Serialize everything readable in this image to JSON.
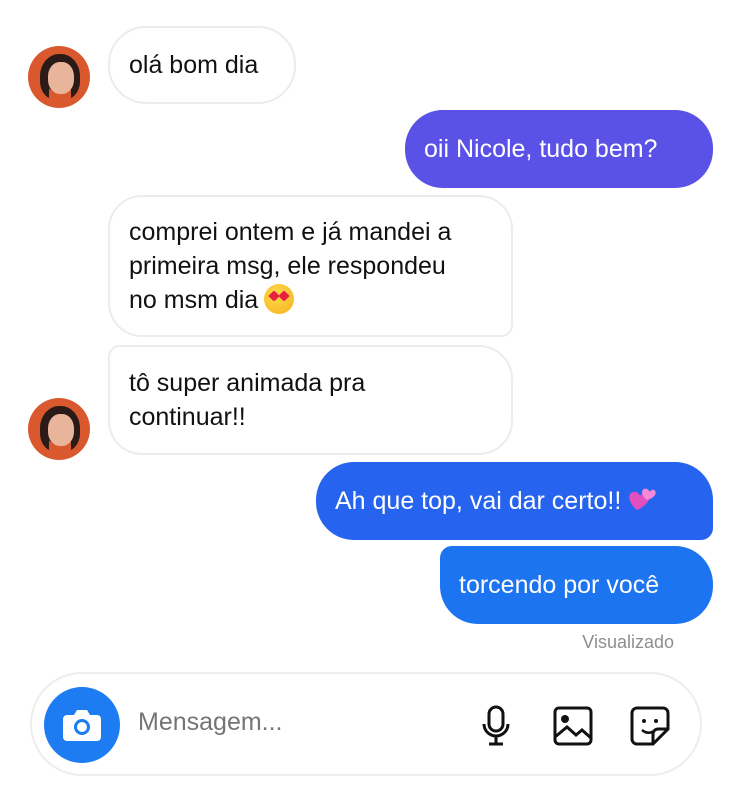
{
  "messages": [
    {
      "side": "in",
      "text": "olá bom dia"
    },
    {
      "side": "out",
      "text": "oii Nicole, tudo bem?"
    },
    {
      "side": "in",
      "lines": [
        "comprei ontem e já mandei a",
        "primeira msg, ele respondeu",
        "no msm dia"
      ],
      "emoji": "smiling-face-with-heart-eyes"
    },
    {
      "side": "in",
      "lines": [
        "tô super animada pra",
        "continuar!!"
      ]
    },
    {
      "side": "out",
      "text": "Ah que top, vai dar certo!!",
      "emoji": "two-hearts"
    },
    {
      "side": "out",
      "text": "torcendo por você"
    }
  ],
  "status": {
    "seen": "Visualizado"
  },
  "composer": {
    "placeholder": "Mensagem...",
    "icons": [
      "camera-icon",
      "microphone-icon",
      "gallery-icon",
      "sticker-icon"
    ]
  },
  "colors": {
    "outgoing_purple": "#5a51e6",
    "outgoing_blue": "#1d74f0",
    "incoming_bg": "#ffffff",
    "incoming_border": "#ececec",
    "camera_button": "#1d7cf2",
    "seen_text": "#8e8e8e"
  }
}
